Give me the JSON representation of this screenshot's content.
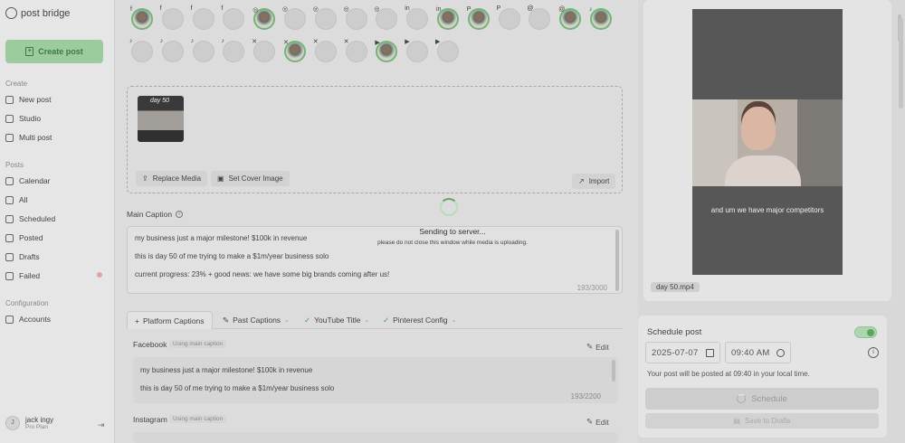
{
  "app": {
    "name": "post bridge"
  },
  "sidebar": {
    "create_label": "Create post",
    "sections": [
      {
        "label": "Create",
        "items": [
          {
            "label": "New post",
            "icon": "edit-icon"
          },
          {
            "label": "Studio",
            "icon": "studio-icon"
          },
          {
            "label": "Multi post",
            "icon": "layers-icon"
          }
        ]
      },
      {
        "label": "Posts",
        "items": [
          {
            "label": "Calendar",
            "icon": "calendar-icon"
          },
          {
            "label": "All",
            "icon": "grid-icon"
          },
          {
            "label": "Scheduled",
            "icon": "clock-icon"
          },
          {
            "label": "Posted",
            "icon": "check-icon"
          },
          {
            "label": "Drafts",
            "icon": "draft-icon"
          },
          {
            "label": "Failed",
            "icon": "alert-icon"
          }
        ]
      },
      {
        "label": "Configuration",
        "items": [
          {
            "label": "Accounts",
            "icon": "users-icon"
          }
        ]
      }
    ],
    "user": {
      "initial": "J",
      "name": "jack ingy",
      "plan": "Pro Plan"
    }
  },
  "accounts": {
    "row1": [
      {
        "platform": "facebook",
        "selected": true
      },
      {
        "platform": "facebook",
        "selected": false
      },
      {
        "platform": "facebook",
        "selected": false
      },
      {
        "platform": "facebook",
        "selected": false
      },
      {
        "platform": "instagram",
        "selected": true
      },
      {
        "platform": "instagram",
        "selected": false
      },
      {
        "platform": "instagram",
        "selected": false
      },
      {
        "platform": "instagram",
        "selected": false
      },
      {
        "platform": "instagram",
        "selected": false
      },
      {
        "platform": "linkedin",
        "selected": false
      },
      {
        "platform": "linkedin",
        "selected": true
      },
      {
        "platform": "pinterest",
        "selected": true
      },
      {
        "platform": "pinterest",
        "selected": false
      },
      {
        "platform": "threads",
        "selected": false
      },
      {
        "platform": "threads",
        "selected": true
      },
      {
        "platform": "tiktok",
        "selected": true
      }
    ],
    "row2": [
      {
        "platform": "tiktok",
        "selected": false
      },
      {
        "platform": "tiktok",
        "selected": false
      },
      {
        "platform": "tiktok",
        "selected": false
      },
      {
        "platform": "tiktok",
        "selected": false
      },
      {
        "platform": "twitter",
        "selected": false
      },
      {
        "platform": "twitter",
        "selected": true
      },
      {
        "platform": "twitter",
        "selected": false
      },
      {
        "platform": "twitter",
        "selected": false
      },
      {
        "platform": "youtube",
        "selected": true
      },
      {
        "platform": "youtube",
        "selected": false
      },
      {
        "platform": "youtube",
        "selected": false
      }
    ]
  },
  "media": {
    "thumb_label": "day 50",
    "replace_label": "Replace Media",
    "cover_label": "Set Cover Image",
    "import_label": "Import"
  },
  "caption": {
    "label": "Main Caption",
    "lines": [
      "my business just a major milestone!  $100k in revenue",
      "this is day 50 of me trying to make a $1m/year business solo",
      "current progress: 23% + good news: we have some big brands coming after us!"
    ],
    "counter": "193/3000"
  },
  "upload": {
    "title": "Sending to server...",
    "subtitle": "please do not close this window while media is uploading."
  },
  "tabs": [
    {
      "label": "Platform Captions",
      "active": true
    },
    {
      "label": "Past Captions",
      "active": false
    },
    {
      "label": "YouTube Title",
      "active": false
    },
    {
      "label": "Pinterest Config",
      "active": false
    }
  ],
  "platform_captions": [
    {
      "name": "Facebook",
      "tag": "Using main caption",
      "edit": "Edit",
      "lines": [
        "my business just a major milestone!  $100k in revenue",
        "this is day 50 of me trying to make a $1m/year business solo"
      ],
      "counter": "193/2200"
    },
    {
      "name": "Instagram",
      "tag": "Using main caption",
      "edit": "Edit"
    }
  ],
  "preview": {
    "video_caption": "and um we have major competitors",
    "file_name": "day 50.mp4"
  },
  "schedule": {
    "title": "Schedule post",
    "enabled": true,
    "date": "2025-07-07",
    "time": "09:40 AM",
    "note": "Your post will be posted at 09:40 in your local time.",
    "schedule_label": "Schedule",
    "draft_label": "Save to Drafts"
  }
}
